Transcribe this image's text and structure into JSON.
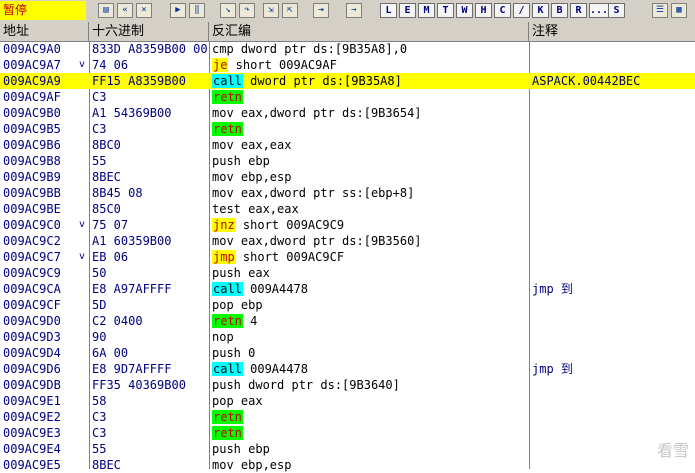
{
  "toolbar": {
    "status": "暂停",
    "letters": [
      "L",
      "E",
      "M",
      "T",
      "W",
      "H",
      "C",
      "/",
      "K",
      "B",
      "R",
      "...",
      "S"
    ]
  },
  "columns": [
    "地址",
    "十六进制",
    "反汇编",
    "注释"
  ],
  "rows": [
    {
      "addr": "009AC9A0",
      "arrow": "",
      "hex": "833D A8359B00 00",
      "kw": "",
      "kwtype": "",
      "rest": "cmp dword ptr ds:[9B35A8],0",
      "cmt": ""
    },
    {
      "addr": "009AC9A7",
      "arrow": "v",
      "hex": "74 06",
      "kw": "je",
      "kwtype": "jcc",
      "rest": " short 009AC9AF",
      "cmt": ""
    },
    {
      "addr": "009AC9A9",
      "arrow": "",
      "hex": "FF15 A8359B00",
      "kw": "call",
      "kwtype": "call",
      "rest": " dword ptr ds:[9B35A8]",
      "cmt": "ASPACK.00442BEC",
      "selected": true
    },
    {
      "addr": "009AC9AF",
      "arrow": "",
      "hex": "C3",
      "kw": "retn",
      "kwtype": "retn",
      "rest": "",
      "cmt": ""
    },
    {
      "addr": "009AC9B0",
      "arrow": "",
      "hex": "A1 54369B00",
      "kw": "",
      "kwtype": "",
      "rest": "mov eax,dword ptr ds:[9B3654]",
      "cmt": ""
    },
    {
      "addr": "009AC9B5",
      "arrow": "",
      "hex": "C3",
      "kw": "retn",
      "kwtype": "retn",
      "rest": "",
      "cmt": ""
    },
    {
      "addr": "009AC9B6",
      "arrow": "",
      "hex": "8BC0",
      "kw": "",
      "kwtype": "",
      "rest": "mov eax,eax",
      "cmt": ""
    },
    {
      "addr": "009AC9B8",
      "arrow": "",
      "hex": "55",
      "kw": "",
      "kwtype": "",
      "rest": "push ebp",
      "cmt": ""
    },
    {
      "addr": "009AC9B9",
      "arrow": "",
      "hex": "8BEC",
      "kw": "",
      "kwtype": "",
      "rest": "mov ebp,esp",
      "cmt": ""
    },
    {
      "addr": "009AC9BB",
      "arrow": "",
      "hex": "8B45 08",
      "kw": "",
      "kwtype": "",
      "rest": "mov eax,dword ptr ss:[ebp+8]",
      "cmt": ""
    },
    {
      "addr": "009AC9BE",
      "arrow": "",
      "hex": "85C0",
      "kw": "",
      "kwtype": "",
      "rest": "test eax,eax",
      "cmt": ""
    },
    {
      "addr": "009AC9C0",
      "arrow": "v",
      "hex": "75 07",
      "kw": "jnz",
      "kwtype": "jcc",
      "rest": " short 009AC9C9",
      "cmt": ""
    },
    {
      "addr": "009AC9C2",
      "arrow": "",
      "hex": "A1 60359B00",
      "kw": "",
      "kwtype": "",
      "rest": "mov eax,dword ptr ds:[9B3560]",
      "cmt": ""
    },
    {
      "addr": "009AC9C7",
      "arrow": "v",
      "hex": "EB 06",
      "kw": "jmp",
      "kwtype": "jmp",
      "rest": " short 009AC9CF",
      "cmt": ""
    },
    {
      "addr": "009AC9C9",
      "arrow": "",
      "hex": "50",
      "kw": "",
      "kwtype": "",
      "rest": "push eax",
      "cmt": ""
    },
    {
      "addr": "009AC9CA",
      "arrow": "",
      "hex": "E8 A97AFFFF",
      "kw": "call",
      "kwtype": "call",
      "rest": " 009A4478",
      "cmt": "jmp 到"
    },
    {
      "addr": "009AC9CF",
      "arrow": "",
      "hex": "5D",
      "kw": "",
      "kwtype": "",
      "rest": "pop ebp",
      "cmt": ""
    },
    {
      "addr": "009AC9D0",
      "arrow": "",
      "hex": "C2 0400",
      "kw": "retn",
      "kwtype": "retn",
      "rest": " 4",
      "cmt": ""
    },
    {
      "addr": "009AC9D3",
      "arrow": "",
      "hex": "90",
      "kw": "",
      "kwtype": "",
      "rest": "nop",
      "cmt": ""
    },
    {
      "addr": "009AC9D4",
      "arrow": "",
      "hex": "6A 00",
      "kw": "",
      "kwtype": "",
      "rest": "push 0",
      "cmt": ""
    },
    {
      "addr": "009AC9D6",
      "arrow": "",
      "hex": "E8 9D7AFFFF",
      "kw": "call",
      "kwtype": "call",
      "rest": " 009A4478",
      "cmt": "jmp 到"
    },
    {
      "addr": "009AC9DB",
      "arrow": "",
      "hex": "FF35 40369B00",
      "kw": "",
      "kwtype": "",
      "rest": "push dword ptr ds:[9B3640]",
      "cmt": ""
    },
    {
      "addr": "009AC9E1",
      "arrow": "",
      "hex": "58",
      "kw": "",
      "kwtype": "",
      "rest": "pop eax",
      "cmt": ""
    },
    {
      "addr": "009AC9E2",
      "arrow": "",
      "hex": "C3",
      "kw": "retn",
      "kwtype": "retn",
      "rest": "",
      "cmt": ""
    },
    {
      "addr": "009AC9E3",
      "arrow": "",
      "hex": "C3",
      "kw": "retn",
      "kwtype": "retn",
      "rest": "",
      "cmt": ""
    },
    {
      "addr": "009AC9E4",
      "arrow": "",
      "hex": "55",
      "kw": "",
      "kwtype": "",
      "rest": "push ebp",
      "cmt": ""
    },
    {
      "addr": "009AC9E5",
      "arrow": "",
      "hex": "8BEC",
      "kw": "",
      "kwtype": "",
      "rest": "mov ebp,esp",
      "cmt": ""
    }
  ],
  "watermark": "看雪"
}
